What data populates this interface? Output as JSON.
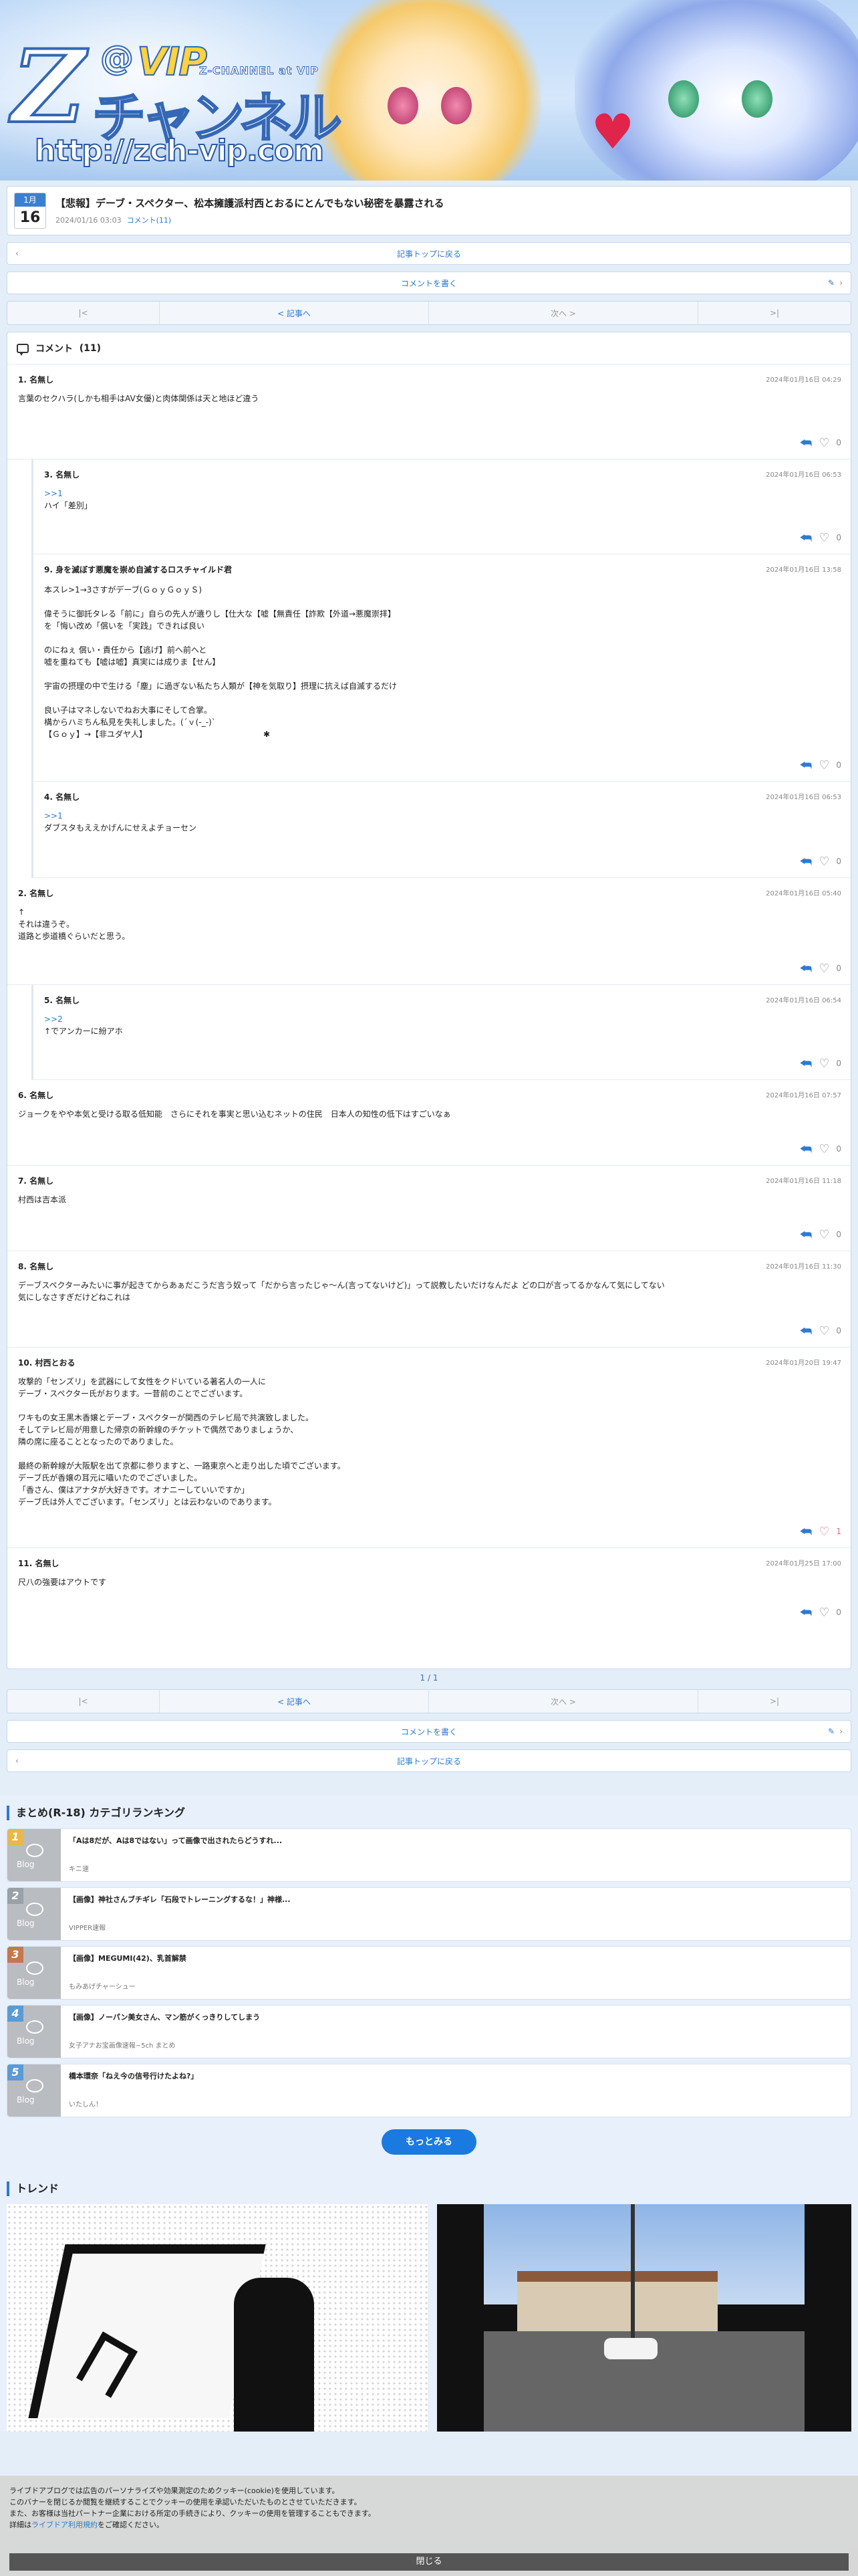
{
  "site": {
    "logo_z": "Z",
    "logo_at": "@",
    "logo_vip": "VIP",
    "logo_channel": "Z-CHANNEL at VIP",
    "logo_kana": "チャンネル",
    "logo_url": "http://zch-vip.com"
  },
  "article": {
    "month": "1月",
    "day": "16",
    "title": "【悲報】デーブ・スペクター、松本擁護派村西とおるにとんでもない秘密を暴露される",
    "date": "2024/01/16 03:03",
    "comment_link": "コメント(11)"
  },
  "nav": {
    "top": "記事トップに戻る",
    "write": "コメントを書く",
    "first": "|<",
    "prev": "< 記事へ",
    "next": "次へ >",
    "last": ">|",
    "page": "1 / 1"
  },
  "comments_header": {
    "label": "コメント",
    "count": "(11)"
  },
  "comments": [
    {
      "no": "1.",
      "name": "名無し",
      "date": "2024年01月16日 04:29",
      "text": "言葉のセクハラ(しかも相手はAV女優)と肉体関係は天と地ほど違う",
      "likes": "0"
    },
    {
      "no": "3.",
      "name": "名無し",
      "date": "2024年01月16日 06:53",
      "anchor": ">>1",
      "text": "ハイ「差別」",
      "likes": "0"
    },
    {
      "no": "9.",
      "name": "身を滅ぼす悪魔を崇め自滅するロスチャイルド君",
      "date": "2024年01月16日 13:58",
      "anchor": "",
      "text": "本スレ>1→3さすがデーブ(ＧｏｙＧｏｙＳ)\n\n偉そうに御託タレる「前に」自らの先人が遺りし【仕大な【嘘【無責任【詐欺【外道→悪魔崇拝】\nを「悔い改め「償いを「実践」できれば良い\n\nのにねぇ 償い・責任から【逃げ】前へ前へと\n嘘を重ねても【嘘は嘘】真実には成りま【せん】\n\n宇宙の摂理の中で生ける「塵」に過ぎない私たち人類が【神を気取り】摂理に抗えば自滅するだけ\n\n良い子はマネしないでねお大事にそして合掌。\n構からハミちん私見を失礼しました。(´ｖ(-_-)`\n【Ｇｏｙ】→【非ユダヤ人】　　　　　　　　　　　　　　　✱",
      "likes": "0"
    },
    {
      "no": "4.",
      "name": "名無し",
      "date": "2024年01月16日 06:53",
      "anchor": ">>1",
      "text": "ダブスタもええかげんにせえよチョーセン",
      "likes": "0"
    },
    {
      "no": "2.",
      "name": "名無し",
      "date": "2024年01月16日 05:40",
      "text": "↑\nそれは違うぞ。\n道路と歩道橋ぐらいだと思う。",
      "likes": "0"
    },
    {
      "no": "5.",
      "name": "名無し",
      "date": "2024年01月16日 06:54",
      "anchor": ">>2",
      "text": "↑でアンカーに紛アホ",
      "likes": "0"
    },
    {
      "no": "6.",
      "name": "名無し",
      "date": "2024年01月16日 07:57",
      "text": "ジョークをやや本気と受ける取る低知能　さらにそれを事実と思い込むネットの住民　日本人の知性の低下はすごいなぁ",
      "likes": "0"
    },
    {
      "no": "7.",
      "name": "名無し",
      "date": "2024年01月16日 11:18",
      "text": "村西は吉本派",
      "likes": "0"
    },
    {
      "no": "8.",
      "name": "名無し",
      "date": "2024年01月16日 11:30",
      "text": "デーブスペクターみたいに事が起きてからあぁだこうだ言う奴って「だから言ったじゃ〜ん(言ってないけど)」って説教したいだけなんだよ どの口が言ってるかなんて気にしてない\n気にしなさすぎだけどねこれは",
      "likes": "0"
    },
    {
      "no": "10.",
      "name": "村西とおる",
      "date": "2024年01月20日 19:47",
      "text": "攻撃的「センズリ」を武器にして女性をクドいている著名人の一人に\nデーブ・スペクター氏がおります。一昔前のことでございます。\n\nワキもの女王黒木香嬢とデーブ・スペクターが関西のテレビ局で共演致しました。\nそしてテレビ局が用意した帰京の新幹線のチケットで偶然でありましょうか、\n隣の席に座ることとなったのでありました。\n\n最終の新幹線が大阪駅を出て京都に参りますと、一路東京へと走り出した頃でございます。\nデーブ氏が香嬢の耳元に囁いたのでございました。\n「香さん、僕はアナタが大好きです。オナニーしていいですか」\nデーブ氏は外人でございます。「センズリ」とは云わないのであります。",
      "likes": "1"
    },
    {
      "no": "11.",
      "name": "名無し",
      "date": "2024年01月25日 17:00",
      "text": "尺八の強要はアウトです",
      "likes": "0"
    }
  ],
  "ranking": {
    "title": "まとめ(R-18) カテゴリランキング",
    "items": [
      {
        "rank": "1",
        "title": "「Aは8だが、Aは8ではない」って画像で出されたらどうすれ...",
        "source": "キニ速",
        "color": "#e8b84a"
      },
      {
        "rank": "2",
        "title": "【画像】神社さんブチギレ「石段でトレーニングするな！」神様...",
        "source": "VIPPER速報",
        "color": "#9aa0a8"
      },
      {
        "rank": "3",
        "title": "【画像】MEGUMI(42)、乳首解禁",
        "source": "もみあげチャーシュー",
        "color": "#c8774a"
      },
      {
        "rank": "4",
        "title": "【画像】ノーパン美女さん、マン筋がくっきりしてしまう",
        "source": "女子アナお宝画像速報−5ch まとめ",
        "color": "#5b9ad6"
      },
      {
        "rank": "5",
        "title": "橋本環奈「ねえ今の信号行けたよね?」",
        "source": "いたしん！",
        "color": "#5b9ad6"
      }
    ],
    "blog_label": "Blog",
    "more": "もっとみる"
  },
  "trend": {
    "title": "トレンド"
  },
  "cookie": {
    "line1": "ライブドアブログでは広告のパーソナライズや効果測定のためクッキー(cookie)を使用しています。",
    "line2": "このバナーを閉じるか閲覧を継続することでクッキーの使用を承認いただいたものとさせていただきます。",
    "line3": "また、お客様は当社パートナー企業における所定の手続きにより、クッキーの使用を管理することもできます。",
    "line4_pre": "詳細は",
    "line4_link": "ライブドア利用規約",
    "line4_post": "をご確認ください。",
    "close": "閉じる"
  },
  "colors": {
    "accent": "#2d7ad1",
    "more_button": "#1a7ae0",
    "like_active": "#e0688a"
  }
}
